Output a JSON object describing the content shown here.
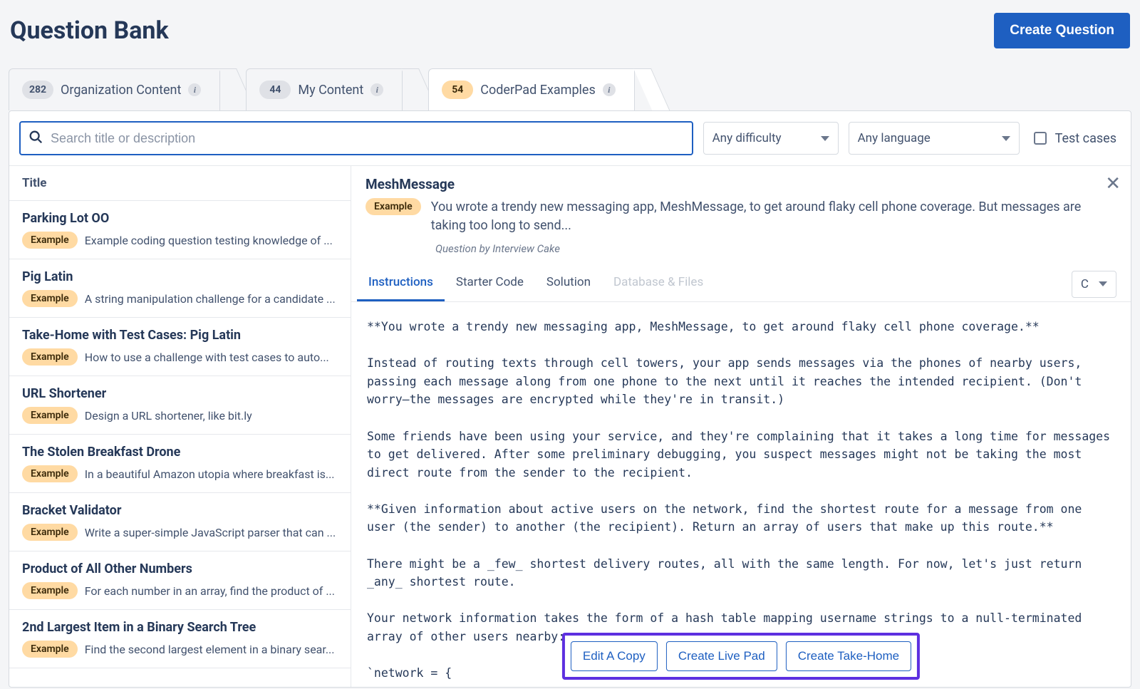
{
  "header": {
    "title": "Question Bank",
    "create_button": "Create Question"
  },
  "tabs": [
    {
      "count": "282",
      "label": "Organization Content",
      "active": false,
      "badge_style": "gray"
    },
    {
      "count": "44",
      "label": "My Content",
      "active": false,
      "badge_style": "gray"
    },
    {
      "count": "54",
      "label": "CoderPad Examples",
      "active": true,
      "badge_style": "orange"
    }
  ],
  "filters": {
    "search_placeholder": "Search title or description",
    "difficulty_label": "Any difficulty",
    "language_label": "Any language",
    "test_cases_label": "Test cases"
  },
  "list": {
    "column_header": "Title",
    "items": [
      {
        "title": "Parking Lot OO",
        "chip": "Example",
        "desc": "Example coding question testing knowledge of ..."
      },
      {
        "title": "Pig Latin",
        "chip": "Example",
        "desc": "A string manipulation challenge for a candidate ..."
      },
      {
        "title": "Take-Home with Test Cases: Pig Latin",
        "chip": "Example",
        "desc": "How to use a challenge with test cases to auto..."
      },
      {
        "title": "URL Shortener",
        "chip": "Example",
        "desc": "Design a URL shortener, like bit.ly"
      },
      {
        "title": "The Stolen Breakfast Drone",
        "chip": "Example",
        "desc": "In a beautiful Amazon utopia where breakfast is..."
      },
      {
        "title": "Bracket Validator",
        "chip": "Example",
        "desc": "Write a super-simple JavaScript parser that can ..."
      },
      {
        "title": "Product of All Other Numbers",
        "chip": "Example",
        "desc": "For each number in an array, find the product of ..."
      },
      {
        "title": "2nd Largest Item in a Binary Search Tree",
        "chip": "Example",
        "desc": "Find the second largest element in a binary sear..."
      }
    ]
  },
  "detail": {
    "title": "MeshMessage",
    "chip": "Example",
    "summary": "You wrote a trendy new messaging app, MeshMessage, to get around flaky cell phone coverage. But messages are taking too long to send...",
    "byline": "Question by Interview Cake",
    "tabs": [
      {
        "label": "Instructions",
        "state": "active"
      },
      {
        "label": "Starter Code",
        "state": "normal"
      },
      {
        "label": "Solution",
        "state": "normal"
      },
      {
        "label": "Database & Files",
        "state": "disabled"
      }
    ],
    "lang_selected": "C",
    "body": "**You wrote a trendy new messaging app, MeshMessage, to get around flaky cell phone coverage.**\n\nInstead of routing texts through cell towers, your app sends messages via the phones of nearby users, passing each message along from one phone to the next until it reaches the intended recipient. (Don't worry—the messages are encrypted while they're in transit.)\n\nSome friends have been using your service, and they're complaining that it takes a long time for messages to get delivered. After some preliminary debugging, you suspect messages might not be taking the most direct route from the sender to the recipient.\n\n**Given information about active users on the network, find the shortest route for a message from one user (the sender) to another (the recipient). Return an array of users that make up this route.**\n\nThere might be a _few_ shortest delivery routes, all with the same length. For now, let's just return _any_ shortest route.\n\nYour network information takes the form of a hash table mapping username strings to a null-terminated array of other users nearby:\n\n`network = {",
    "actions": {
      "edit_copy": "Edit A Copy",
      "create_live_pad": "Create Live Pad",
      "create_take_home": "Create Take-Home"
    }
  }
}
